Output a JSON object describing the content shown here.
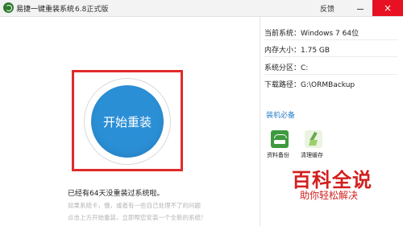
{
  "titlebar": {
    "title": "易捷一键重装系统",
    "version": "6.8正式版",
    "feedback": "反馈",
    "close_glyph": "×"
  },
  "main": {
    "start_label": "开始重装",
    "days_message": "已经有64天没重装过系统啦。",
    "hint_line1": "如果系统卡，慢，或者有一些自己处理不了的问题",
    "hint_line2": "点击上方开始重装，立即帮您安装一个全新的系统！"
  },
  "info": {
    "rows": [
      {
        "key": "当前系统：",
        "value": "Windows 7 64位"
      },
      {
        "key": "内存大小：",
        "value": "1.75 GB"
      },
      {
        "key": "系统分区：",
        "value": "C:"
      },
      {
        "key": "下载路径：",
        "value": "G:\\ORMBackup"
      }
    ]
  },
  "tools": {
    "title": "装机必备",
    "items": [
      {
        "label": "资料备份",
        "icon": "backup-icon"
      },
      {
        "label": "清理缓存",
        "icon": "broom-icon"
      }
    ]
  },
  "watermark": {
    "big": "百科全说",
    "small": "助你轻松解决"
  },
  "colors": {
    "accent": "#2b8fd6",
    "highlight": "#e02a2a",
    "close_button": "#e81123",
    "link": "#2b7fc4",
    "watermark": "#d21f1f"
  }
}
